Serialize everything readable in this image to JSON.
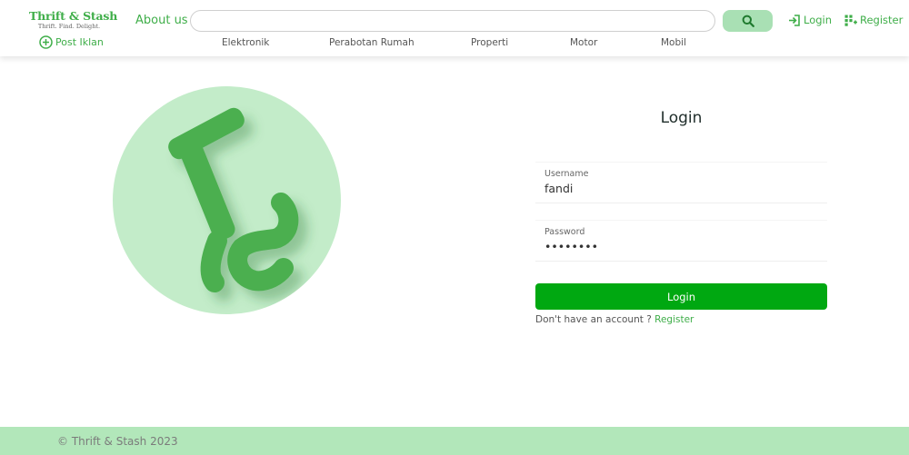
{
  "header": {
    "logo_title": "Thrift & Stash",
    "logo_tagline": "Thrift. Find. Delight.",
    "about_label": "About us",
    "search_placeholder": "",
    "search_icon": "search-icon",
    "login_label": "Login",
    "register_label": "Register",
    "post_label": "Post Iklan",
    "categories": [
      "Elektronik",
      "Perabotan Rumah",
      "Properti",
      "Motor",
      "Mobil"
    ]
  },
  "hero": {
    "logo_letters": "TS"
  },
  "login": {
    "title": "Login",
    "username_label": "Username",
    "username_value": "fandi",
    "password_label": "Password",
    "password_value": "••••••••",
    "button_label": "Login",
    "signup_text": "Don't have an account ? ",
    "signup_link": "Register"
  },
  "footer": {
    "copyright": "© Thrift & Stash 2023"
  },
  "colors": {
    "accent": "#3fae49",
    "button": "#00a811",
    "search_button": "#a9e0b4",
    "circle": "#c3ecc9",
    "footer": "#b2e7ba"
  }
}
